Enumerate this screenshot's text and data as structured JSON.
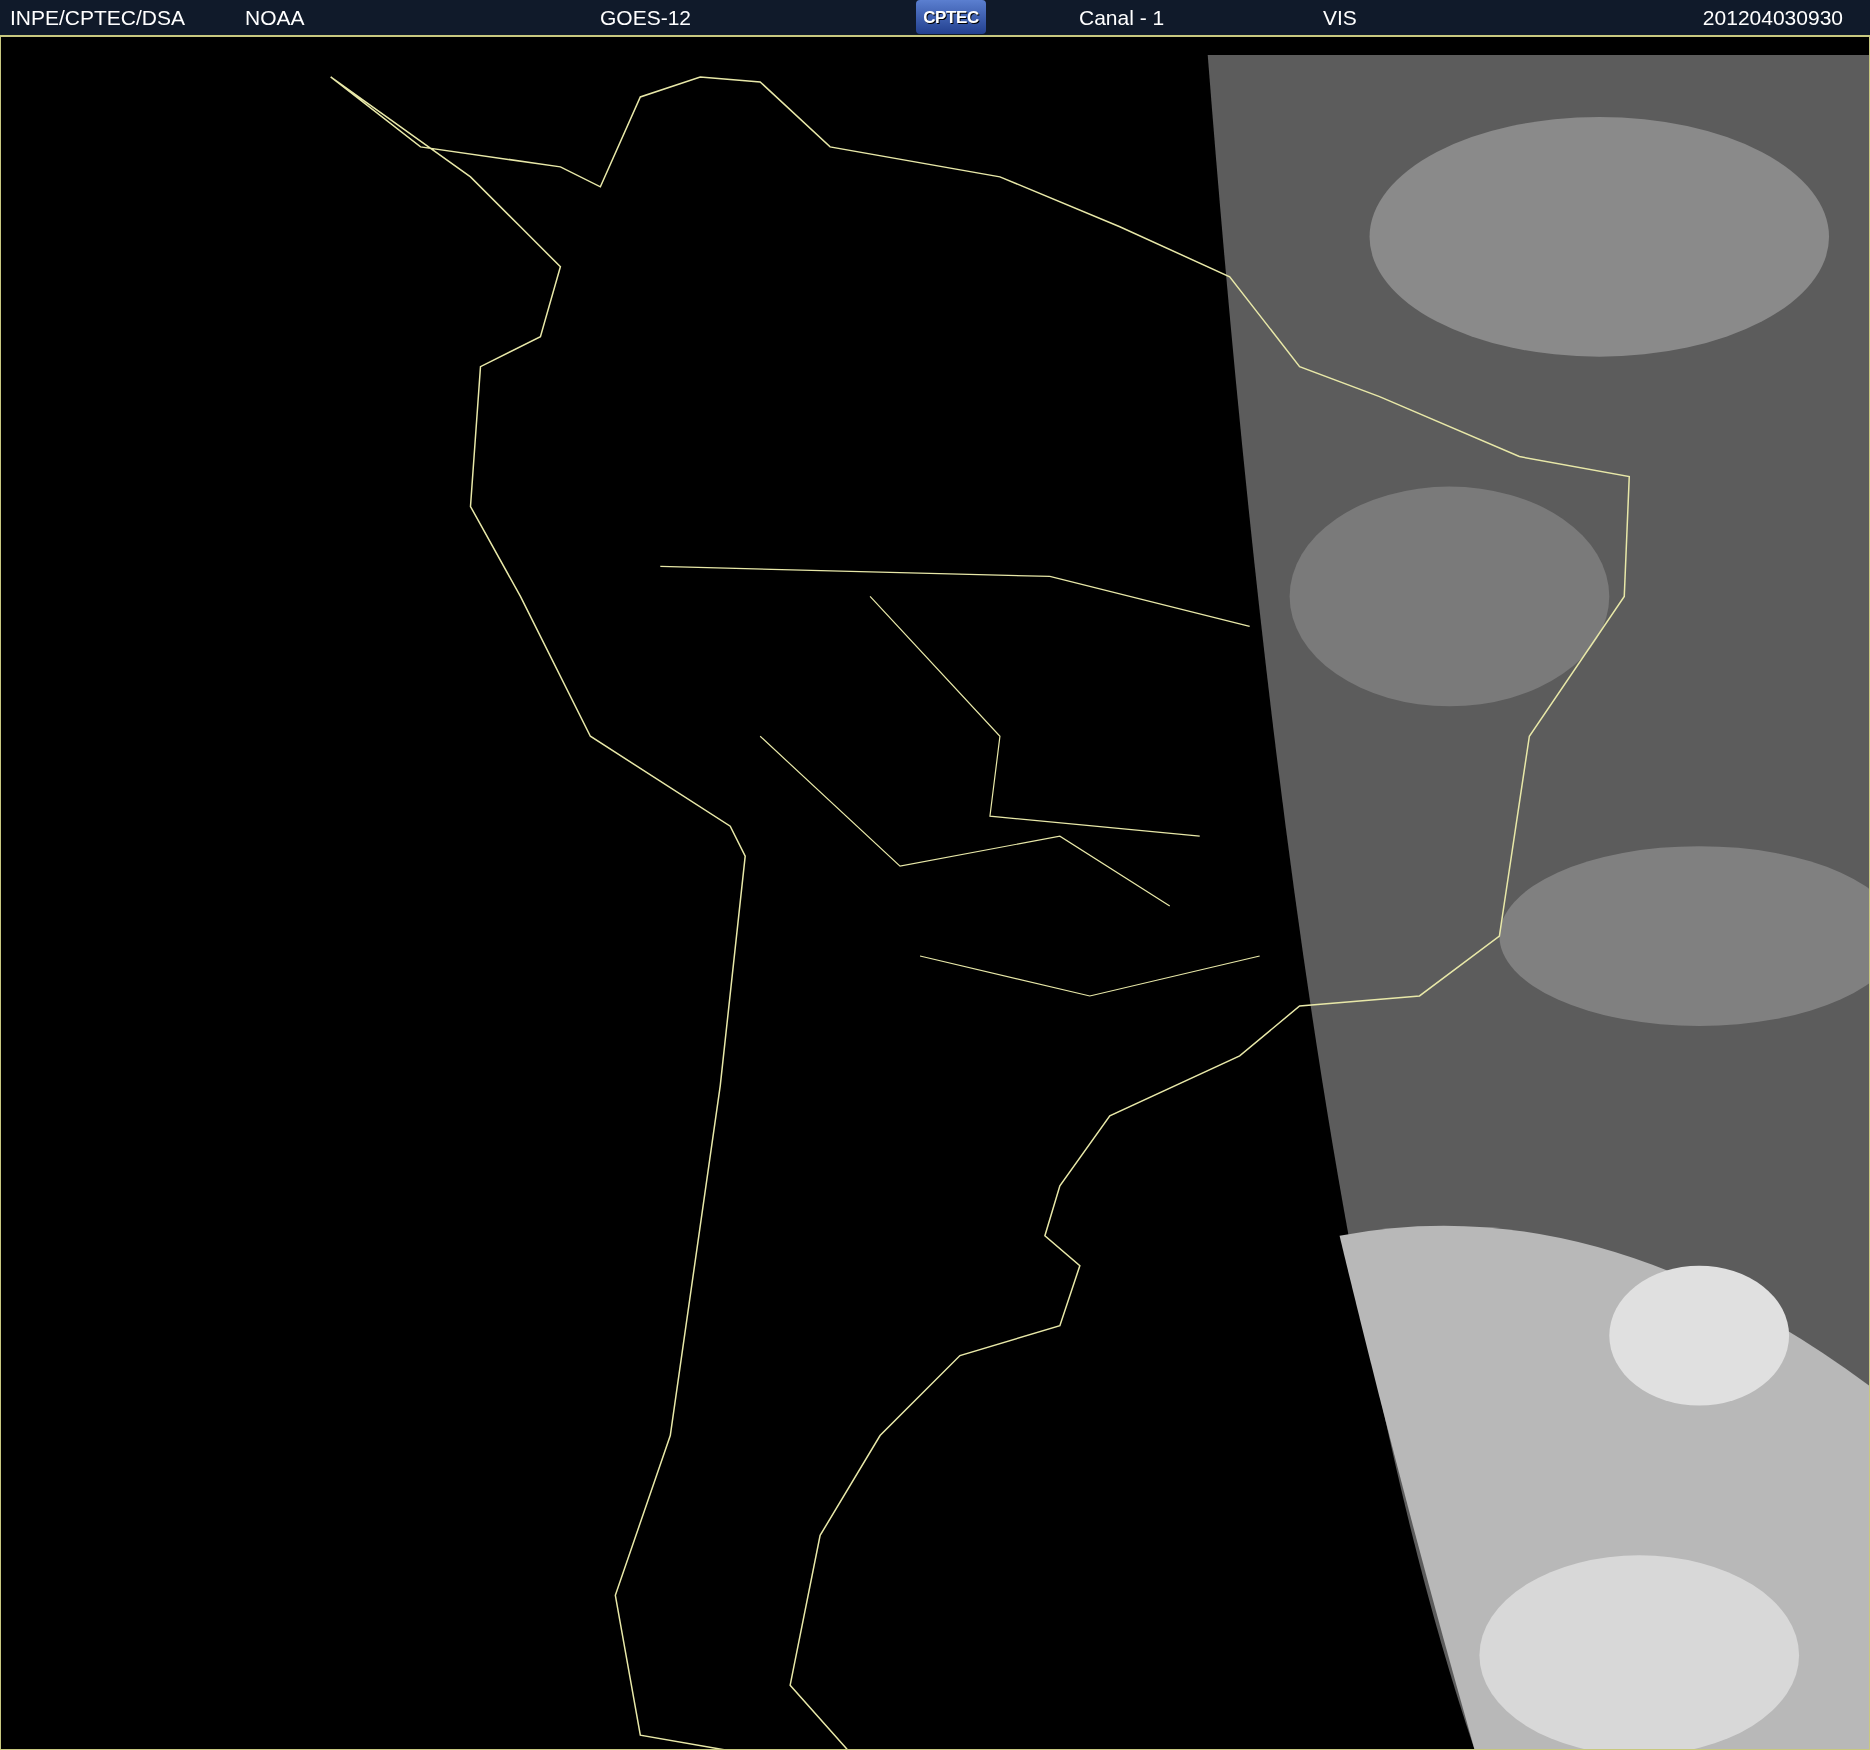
{
  "header": {
    "items": [
      {
        "kind": "text",
        "text": "INPE/CPTEC/DSA"
      },
      {
        "kind": "text",
        "text": "NOAA"
      },
      {
        "kind": "text",
        "text": "GOES-12"
      },
      {
        "kind": "logo",
        "text": "CPTEC"
      },
      {
        "kind": "text",
        "text": "Canal - 1"
      },
      {
        "kind": "text",
        "text": "VIS"
      },
      {
        "kind": "text",
        "text": "201204030930"
      }
    ]
  }
}
